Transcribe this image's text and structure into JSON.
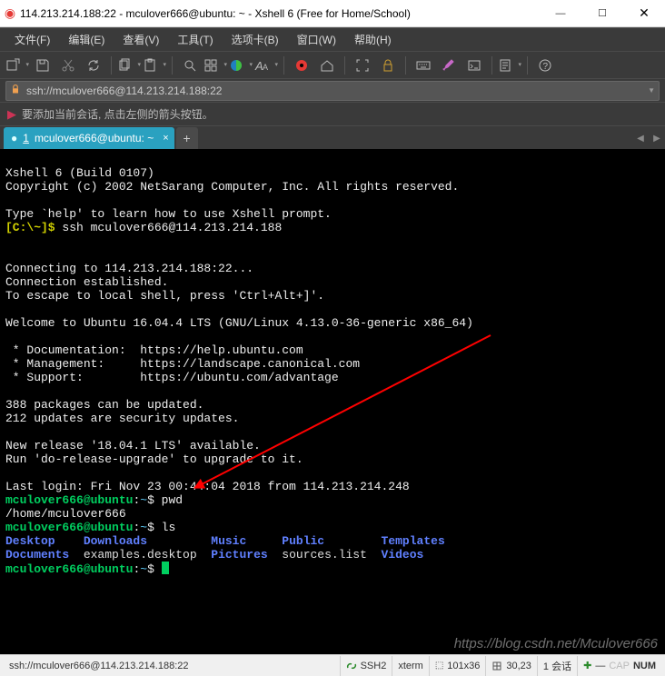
{
  "title": "114.213.214.188:22 - mculover666@ubuntu: ~ - Xshell 6 (Free for Home/School)",
  "menu": {
    "file": "文件(F)",
    "edit": "编辑(E)",
    "view": "查看(V)",
    "tools": "工具(T)",
    "tabs": "选项卡(B)",
    "window": "窗口(W)",
    "help": "帮助(H)"
  },
  "address": "ssh://mculover666@114.213.214.188:22",
  "hint": "要添加当前会话, 点击左侧的箭头按钮。",
  "tab": {
    "index": "1",
    "label": "mculover666@ubuntu: ~",
    "close": "×",
    "add": "+"
  },
  "term": {
    "l1": "Xshell 6 (Build 0107)",
    "l2": "Copyright (c) 2002 NetSarang Computer, Inc. All rights reserved.",
    "l4": "Type `help' to learn how to use Xshell prompt.",
    "prompt_local": "[C:\\~]$ ",
    "cmd_ssh": "ssh mculover666@114.213.214.188",
    "conn1": "Connecting to 114.213.214.188:22...",
    "conn2": "Connection established.",
    "conn3": "To escape to local shell, press 'Ctrl+Alt+]'.",
    "welcome": "Welcome to Ubuntu 16.04.4 LTS (GNU/Linux 4.13.0-36-generic x86_64)",
    "doc": " * Documentation:  https://help.ubuntu.com",
    "mgmt": " * Management:     https://landscape.canonical.com",
    "sup": " * Support:        https://ubuntu.com/advantage",
    "pkg1": "388 packages can be updated.",
    "pkg2": "212 updates are security updates.",
    "rel1": "New release '18.04.1 LTS' available.",
    "rel2": "Run 'do-release-upgrade' to upgrade to it.",
    "login": "Last login: Fri Nov 23 00:44:04 2018 from 114.213.214.248",
    "ps_user": "mculover666@ubuntu",
    "ps_sep": ":",
    "ps_path": "~",
    "ps_dollar": "$ ",
    "cmd_pwd": "pwd",
    "out_pwd": "/home/mculover666",
    "cmd_ls": "ls",
    "ls_row1_1": "Desktop",
    "ls_row1_2": "Downloads",
    "ls_row1_3": "Music",
    "ls_row1_4": "Public",
    "ls_row1_5": "Templates",
    "ls_row2_1": "Documents",
    "ls_row2_2": "examples.desktop",
    "ls_row2_3": "Pictures",
    "ls_row2_4": "sources.list",
    "ls_row2_5": "Videos"
  },
  "watermark": "https://blog.csdn.net/Mculover666",
  "status": {
    "conn": "ssh://mculover666@114.213.214.188:22",
    "proto": "SSH2",
    "termtype": "xterm",
    "size": "101x36",
    "cursor": "30,23",
    "sessions": "1 会话",
    "cap": "CAP",
    "num": "NUM"
  }
}
